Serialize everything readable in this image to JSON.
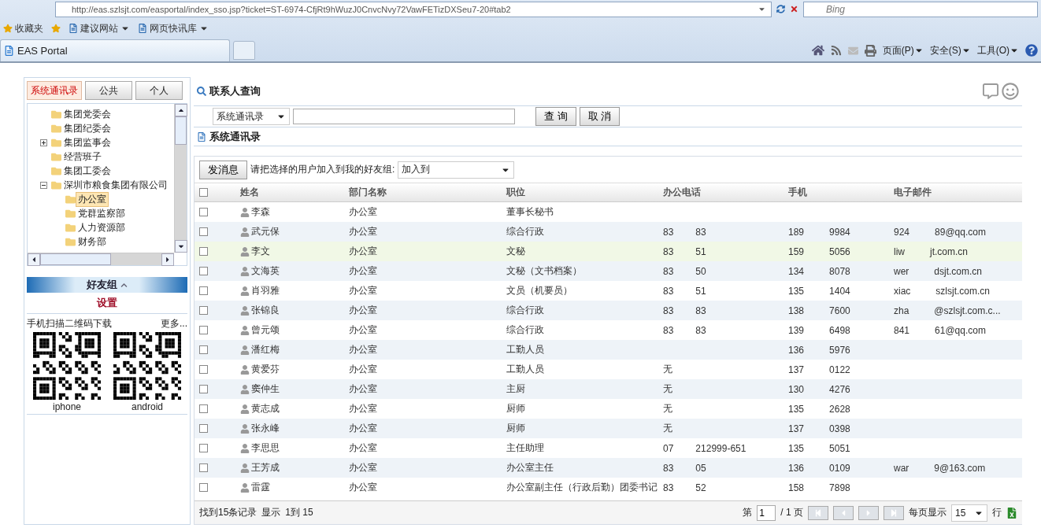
{
  "browser": {
    "address": "http://eas.szlsjt.com/easportal/index_sso.jsp?ticket=ST-6974-CfjRt9hWuzJ0CnvcNvy72VawFETizDXSeu7-20#tab2",
    "search_placeholder": "Bing",
    "favorites_label": "收藏夹",
    "favorites": [
      "建议网站",
      "网页快讯库"
    ],
    "tab_title": "EAS Portal",
    "commands": [
      "页面(P)",
      "安全(S)",
      "工具(O)"
    ]
  },
  "left": {
    "tabs": [
      {
        "label": "系统通讯录",
        "selected": true
      },
      {
        "label": "公共",
        "selected": false
      },
      {
        "label": "个人",
        "selected": false
      }
    ],
    "tree": [
      {
        "label": "集团党委会",
        "selected": false
      },
      {
        "label": "集团纪委会",
        "selected": false
      },
      {
        "label": "集团监事会",
        "selected": false,
        "expanded": false
      },
      {
        "label": "经营班子",
        "selected": false
      },
      {
        "label": "集团工委会",
        "selected": false
      },
      {
        "label": "深圳市粮食集团有限公司",
        "selected": false,
        "expanded": true,
        "children": [
          {
            "label": "办公室",
            "selected": true
          },
          {
            "label": "党群监察部",
            "selected": false
          },
          {
            "label": "人力资源部",
            "selected": false
          },
          {
            "label": "财务部",
            "selected": false
          }
        ]
      }
    ],
    "friends_title": "好友组",
    "settings": "设置",
    "qr_title": "手机扫描二维码下载",
    "more": "更多...",
    "qr": [
      {
        "label": "iphone"
      },
      {
        "label": "android"
      }
    ]
  },
  "search": {
    "title": "联系人查询",
    "scope": "系统通讯录",
    "buttons": [
      "查 询",
      "取 消"
    ]
  },
  "list_title": "系统通讯录",
  "toolbar": {
    "send": "发消息",
    "prompt": "请把选择的用户加入到我的好友组:",
    "group_select": "加入到"
  },
  "table": {
    "columns": [
      "姓名",
      "部门名称",
      "职位",
      "办公电话",
      "手机",
      "电子邮件"
    ],
    "all_checked": false,
    "rows": [
      {
        "name": "李森",
        "dept": "办公室",
        "title": "董事长秘书",
        "office": [],
        "mobile": [],
        "email": [],
        "checked": false,
        "selected": false
      },
      {
        "name": "武元保",
        "dept": "办公室",
        "title": "综合行政",
        "office": [
          "83",
          "83"
        ],
        "mobile": [
          "189",
          "9984"
        ],
        "email": [
          "924",
          "89@qq.com"
        ],
        "checked": false,
        "selected": false
      },
      {
        "name": "李文",
        "dept": "办公室",
        "title": "文秘",
        "office": [
          "83",
          "51"
        ],
        "mobile": [
          "159",
          "5056"
        ],
        "email": [
          "liw",
          "jt.com.cn"
        ],
        "checked": false,
        "selected": true
      },
      {
        "name": "文海英",
        "dept": "办公室",
        "title": "文秘（文书档案）",
        "office": [
          "83",
          "50"
        ],
        "mobile": [
          "134",
          "8078"
        ],
        "email": [
          "wer",
          "dsjt.com.cn"
        ],
        "checked": false,
        "selected": false
      },
      {
        "name": "肖羽雅",
        "dept": "办公室",
        "title": "文员（机要员）",
        "office": [
          "83",
          "51"
        ],
        "mobile": [
          "135",
          "1404"
        ],
        "email": [
          "xiac",
          "szlsjt.com.cn"
        ],
        "checked": false,
        "selected": false
      },
      {
        "name": "张锦良",
        "dept": "办公室",
        "title": "综合行政",
        "office": [
          "83",
          "83"
        ],
        "mobile": [
          "138",
          "7600"
        ],
        "email": [
          "zha",
          "@szlsjt.com.c..."
        ],
        "checked": false,
        "selected": false
      },
      {
        "name": "曾元颂",
        "dept": "办公室",
        "title": "综合行政",
        "office": [
          "83",
          "83"
        ],
        "mobile": [
          "139",
          "6498"
        ],
        "email": [
          "841",
          "61@qq.com"
        ],
        "checked": false,
        "selected": false
      },
      {
        "name": "潘红梅",
        "dept": "办公室",
        "title": "工勤人员",
        "office": [],
        "mobile": [
          "136",
          "5976"
        ],
        "email": [],
        "checked": false,
        "selected": false
      },
      {
        "name": "黄爱芬",
        "dept": "办公室",
        "title": "工勤人员",
        "office": [
          "无"
        ],
        "mobile": [
          "137",
          "0122"
        ],
        "email": [],
        "checked": false,
        "selected": false
      },
      {
        "name": "窦仲生",
        "dept": "办公室",
        "title": "主厨",
        "office": [
          "无"
        ],
        "mobile": [
          "130",
          "4276"
        ],
        "email": [],
        "checked": false,
        "selected": false
      },
      {
        "name": "黄志成",
        "dept": "办公室",
        "title": "厨师",
        "office": [
          "无"
        ],
        "mobile": [
          "135",
          "2628"
        ],
        "email": [],
        "checked": false,
        "selected": false
      },
      {
        "name": "张永峰",
        "dept": "办公室",
        "title": "厨师",
        "office": [
          "无"
        ],
        "mobile": [
          "137",
          "0398"
        ],
        "email": [],
        "checked": false,
        "selected": false
      },
      {
        "name": "李思思",
        "dept": "办公室",
        "title": "主任助理",
        "office": [
          "07",
          "212999-651"
        ],
        "mobile": [
          "135",
          "5051"
        ],
        "email": [],
        "checked": false,
        "selected": false
      },
      {
        "name": "王芳成",
        "dept": "办公室",
        "title": "办公室主任",
        "office": [
          "83",
          "05"
        ],
        "mobile": [
          "136",
          "0109"
        ],
        "email": [
          "war",
          "9@163.com"
        ],
        "checked": false,
        "selected": false
      },
      {
        "name": "雷霆",
        "dept": "办公室",
        "title": "办公室副主任（行政后勤）团委书记",
        "office": [
          "83",
          "52"
        ],
        "mobile": [
          "158",
          "7898"
        ],
        "email": [],
        "checked": false,
        "selected": false
      }
    ]
  },
  "footer": {
    "found": "找到15条记录",
    "shown_label": "显示",
    "range": "1到  15",
    "page_label": "第",
    "page": "1",
    "pages": "/ 1 页",
    "per_page_label": "每页显示",
    "per_page": "15",
    "per_page_unit": "行"
  }
}
